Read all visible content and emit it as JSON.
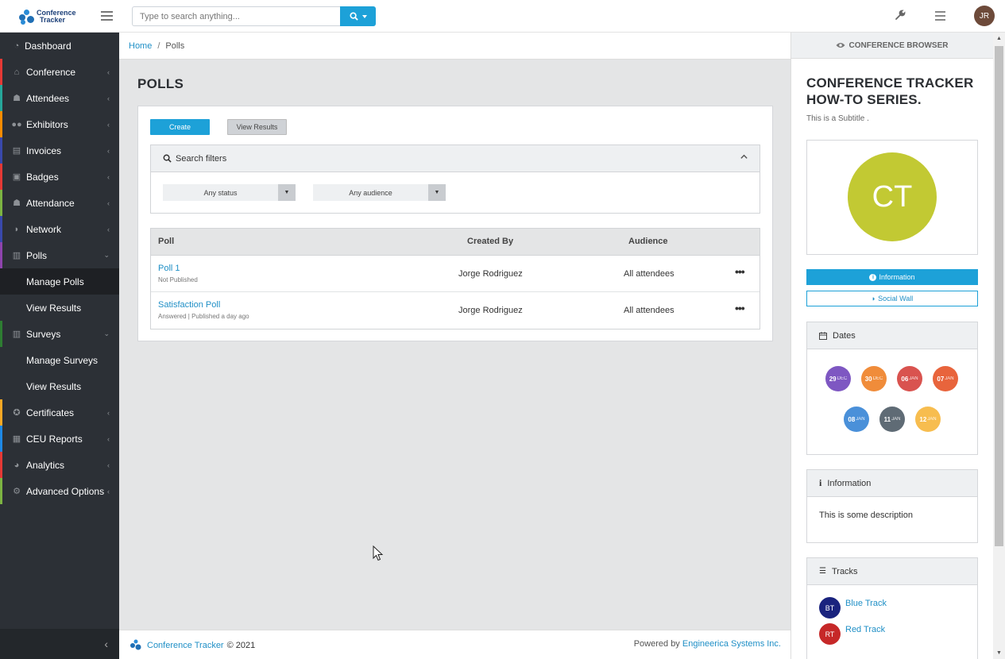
{
  "app": {
    "logo_line1": "Conference",
    "logo_line2": "Tracker",
    "avatar_initials": "JR"
  },
  "search": {
    "placeholder": "Type to search anything..."
  },
  "sidebar": {
    "items": [
      {
        "label": "Dashboard",
        "icon": "dashboard-icon",
        "color": "#2c3036"
      },
      {
        "label": "Conference",
        "icon": "home-icon",
        "color": "#e53935"
      },
      {
        "label": "Attendees",
        "icon": "attendee-icon",
        "color": "#26a69a"
      },
      {
        "label": "Exhibitors",
        "icon": "users-icon",
        "color": "#fb8c00"
      },
      {
        "label": "Invoices",
        "icon": "invoice-icon",
        "color": "#3949ab"
      },
      {
        "label": "Badges",
        "icon": "badge-icon",
        "color": "#e53935"
      },
      {
        "label": "Attendance",
        "icon": "attendance-icon",
        "color": "#7cb342"
      },
      {
        "label": "Network",
        "icon": "chat-icon",
        "color": "#3949ab"
      },
      {
        "label": "Polls",
        "icon": "chart-icon",
        "color": "#8e44ad"
      },
      {
        "label": "Surveys",
        "icon": "survey-icon",
        "color": "#2e7d32"
      },
      {
        "label": "Certificates",
        "icon": "medal-icon",
        "color": "#f9a825"
      },
      {
        "label": "CEU Reports",
        "icon": "report-icon",
        "color": "#1e88e5"
      },
      {
        "label": "Analytics",
        "icon": "pie-icon",
        "color": "#e53935"
      },
      {
        "label": "Advanced Options",
        "icon": "gears-icon",
        "color": "#7cb342"
      }
    ],
    "polls_sub": [
      "Manage Polls",
      "View Results"
    ],
    "surveys_sub": [
      "Manage Surveys",
      "View Results"
    ]
  },
  "breadcrumb": {
    "home": "Home",
    "separator": "/",
    "current": "Polls"
  },
  "page": {
    "title": "POLLS",
    "create_label": "Create",
    "view_results_label": "View Results",
    "filters_title": "Search filters",
    "status_select": "Any status",
    "audience_select": "Any audience"
  },
  "table": {
    "headers": {
      "poll": "Poll",
      "created_by": "Created By",
      "audience": "Audience"
    },
    "rows": [
      {
        "name": "Poll 1",
        "meta": "Not Published",
        "created_by": "Jorge Rodriguez",
        "audience": "All attendees",
        "actions": "•••"
      },
      {
        "name": "Satisfaction Poll",
        "meta": "Answered | Published a day ago",
        "created_by": "Jorge Rodriguez",
        "audience": "All attendees",
        "actions": "•••"
      }
    ]
  },
  "footer": {
    "brand": "Conference Tracker",
    "copyright": "© 2021",
    "powered_by": "Powered by",
    "company": "Engineerica Systems Inc."
  },
  "right_panel": {
    "header": "CONFERENCE BROWSER",
    "title": "CONFERENCE TRACKER HOW-TO SERIES.",
    "subtitle": "This is a Subtitle .",
    "logo_initials": "CT",
    "logo_color": "#c2c933",
    "info_button": "Information",
    "wall_button": "Social Wall",
    "dates_title": "Dates",
    "dates": [
      {
        "day": "29",
        "month": "DEC",
        "color": "#7e57c2"
      },
      {
        "day": "30",
        "month": "DEC",
        "color": "#f08c3a"
      },
      {
        "day": "06",
        "month": "JAN",
        "color": "#d9534f"
      },
      {
        "day": "07",
        "month": "JAN",
        "color": "#e8643c"
      },
      {
        "day": "08",
        "month": "JAN",
        "color": "#4a90d9"
      },
      {
        "day": "11",
        "month": "JAN",
        "color": "#5f6b75"
      },
      {
        "day": "12",
        "month": "JAN",
        "color": "#f7bd4f"
      }
    ],
    "information_title": "Information",
    "information_text": "This is some description",
    "tracks_title": "Tracks",
    "tracks": [
      {
        "initials": "BT",
        "name": "Blue Track",
        "color": "#1a237e"
      },
      {
        "initials": "RT",
        "name": "Red Track",
        "color": "#c62828"
      }
    ]
  }
}
